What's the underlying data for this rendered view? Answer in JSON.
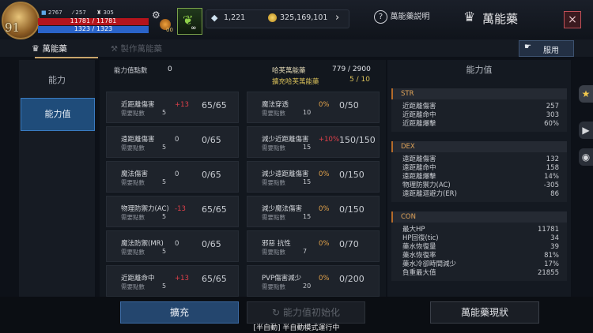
{
  "player": {
    "level": "91",
    "stat1": "2767",
    "stat2": "257",
    "stat3": "305",
    "hp": "11781 / 11781",
    "mp": "1323 / 1323",
    "potion_count": "00"
  },
  "currency": {
    "gems": "1,221",
    "gold": "325,169,101"
  },
  "header": {
    "help_label": "萬能藥説明",
    "title": "萬能藥",
    "close_icon": "×"
  },
  "tabs": {
    "active": "萬能藥",
    "inactive": "製作萬能藥",
    "use_button": "服用"
  },
  "sidebar": {
    "items": [
      {
        "label": "能力"
      },
      {
        "label": "能力值"
      }
    ]
  },
  "center": {
    "points_label": "能力值點數",
    "points_value": "0",
    "potion_label": "哈芙萬能藥",
    "potion_value": "779 / 2900",
    "expand_label": "擴充哈芙萬能藥",
    "expand_value": "5 / 10",
    "req_label": "需要點數",
    "cards_left": [
      {
        "name": "近距離傷害",
        "bonus": "+13",
        "ratio": "65/65",
        "req": "5"
      },
      {
        "name": "遠距離傷害",
        "bonus": "0",
        "ratio": "0/65",
        "req": "5"
      },
      {
        "name": "魔法傷害",
        "bonus": "0",
        "ratio": "0/65",
        "req": "5"
      },
      {
        "name": "物理防禦力(AC)",
        "bonus": "-13",
        "ratio": "65/65",
        "req": "5"
      },
      {
        "name": "魔法防禦(MR)",
        "bonus": "0",
        "ratio": "0/65",
        "req": "5"
      },
      {
        "name": "近距離命中",
        "bonus": "+13",
        "ratio": "65/65",
        "req": "5"
      }
    ],
    "cards_right": [
      {
        "name": "魔法穿透",
        "bonus": "0%",
        "ratio": "0/50",
        "req": "10"
      },
      {
        "name": "減少近距離傷害",
        "bonus": "+10%",
        "ratio": "150/150",
        "req": "15"
      },
      {
        "name": "減少遠距離傷害",
        "bonus": "0%",
        "ratio": "0/150",
        "req": "15"
      },
      {
        "name": "減少魔法傷害",
        "bonus": "0%",
        "ratio": "0/150",
        "req": "15"
      },
      {
        "name": "邪惡 抗性",
        "bonus": "0%",
        "ratio": "0/70",
        "req": "7"
      },
      {
        "name": "PVP傷害減少",
        "bonus": "0%",
        "ratio": "0/200",
        "req": "20"
      }
    ]
  },
  "stats_panel": {
    "title": "能力值",
    "sections": [
      {
        "header": "STR",
        "rows": [
          {
            "k": "近距離傷害",
            "v": "257"
          },
          {
            "k": "近距離命中",
            "v": "303"
          },
          {
            "k": "近距離爆擊",
            "v": "60%"
          }
        ]
      },
      {
        "header": "DEX",
        "rows": [
          {
            "k": "遠距離傷害",
            "v": "132"
          },
          {
            "k": "遠距離命中",
            "v": "158"
          },
          {
            "k": "遠距離爆擊",
            "v": "14%"
          },
          {
            "k": "物理防禦力(AC)",
            "v": "-305"
          },
          {
            "k": "遠距離迴避力(ER)",
            "v": "86"
          }
        ]
      },
      {
        "header": "CON",
        "rows": [
          {
            "k": "最大HP",
            "v": "11781"
          },
          {
            "k": "HP回復(tic)",
            "v": "34"
          },
          {
            "k": "藥水恢復量",
            "v": "39"
          },
          {
            "k": "藥水恢復率",
            "v": "81%"
          },
          {
            "k": "藥水冷卻時間減少",
            "v": "17%"
          },
          {
            "k": "負重最大值",
            "v": "21855"
          }
        ]
      }
    ]
  },
  "footer": {
    "expand_button": "擴充",
    "reset_button": "能力值初始化",
    "status_button": "萬能藥現狀",
    "auto_text": "[半自動] 半自動模式運行中"
  },
  "colors": {
    "plus": "#e0404a",
    "minus": "#e0404a",
    "percent": "#e2a24a",
    "accent": "#2e6fb0"
  }
}
